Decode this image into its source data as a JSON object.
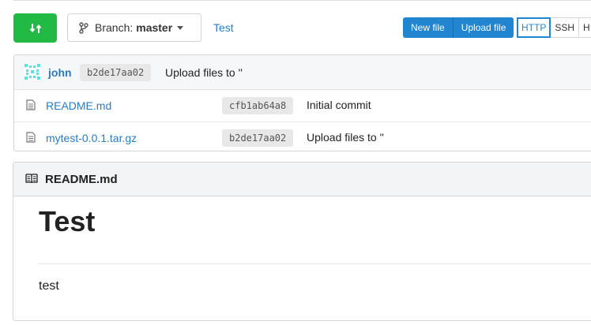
{
  "toolbar": {
    "branch_label": "Branch:",
    "branch_name": "master",
    "breadcrumb": "Test",
    "new_file": "New file",
    "upload_file": "Upload file",
    "protocols": [
      "HTTP",
      "SSH",
      "H"
    ],
    "active_protocol": "HTTP"
  },
  "latest_commit": {
    "author": "john",
    "sha": "b2de17aa02",
    "message": "Upload files to ''"
  },
  "files": [
    {
      "name": "README.md",
      "sha": "cfb1ab64a8",
      "message": "Initial commit"
    },
    {
      "name": "mytest-0.0.1.tar.gz",
      "sha": "b2de17aa02",
      "message": "Upload files to ''"
    }
  ],
  "readme": {
    "header": "README.md",
    "heading": "Test",
    "body": "test"
  },
  "colors": {
    "green": "#21ba45",
    "blue": "#2185d0",
    "link": "#2a7bc0"
  }
}
